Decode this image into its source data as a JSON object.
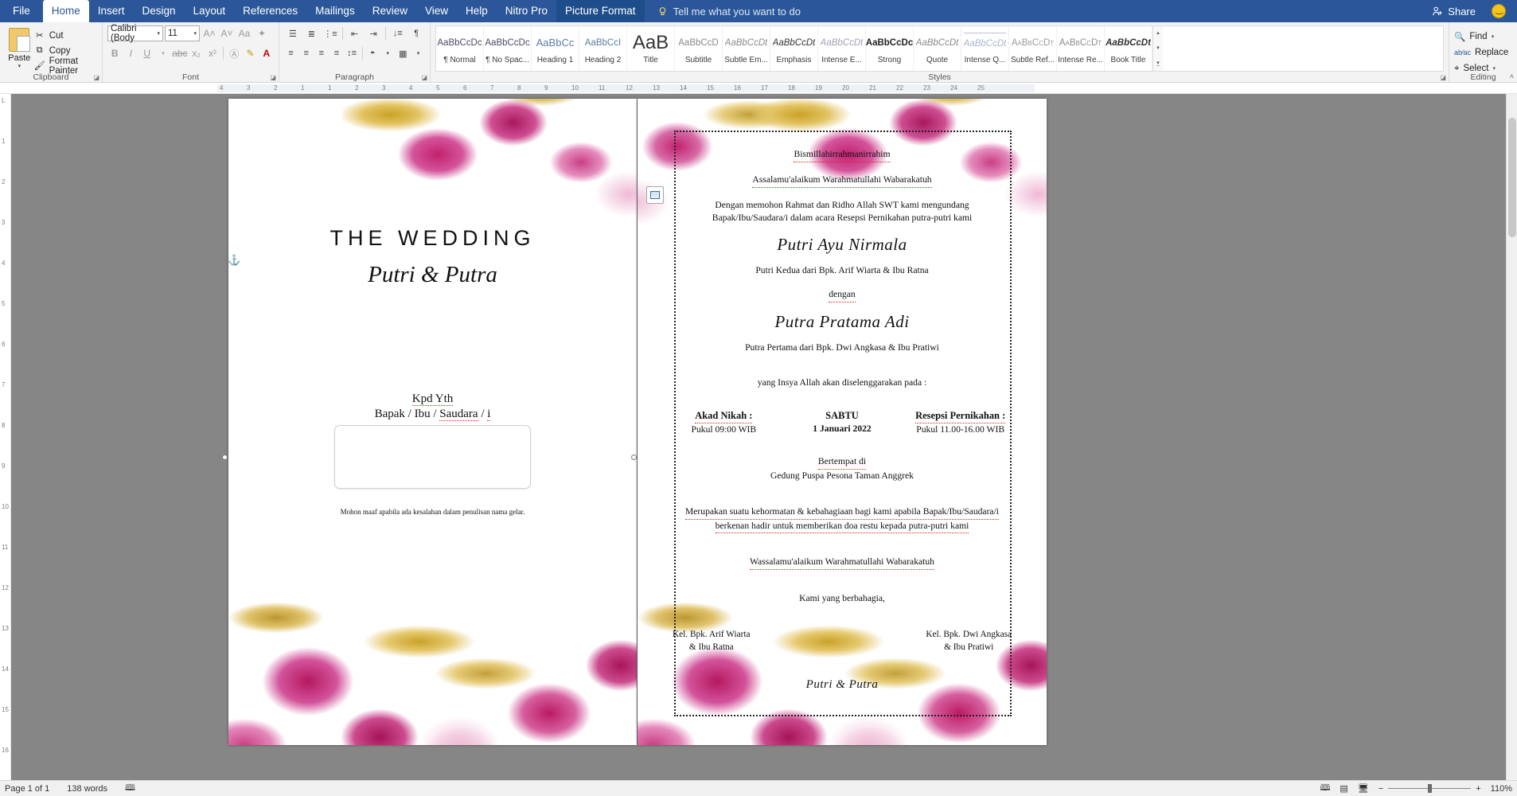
{
  "titlebar": {
    "tabs": [
      {
        "label": "File",
        "state": "file"
      },
      {
        "label": "Home",
        "state": "active"
      },
      {
        "label": "Insert",
        "state": "normal"
      },
      {
        "label": "Design",
        "state": "normal"
      },
      {
        "label": "Layout",
        "state": "normal"
      },
      {
        "label": "References",
        "state": "normal"
      },
      {
        "label": "Mailings",
        "state": "normal"
      },
      {
        "label": "Review",
        "state": "normal"
      },
      {
        "label": "View",
        "state": "normal"
      },
      {
        "label": "Help",
        "state": "normal"
      },
      {
        "label": "Nitro Pro",
        "state": "normal"
      },
      {
        "label": "Picture Format",
        "state": "contextual"
      }
    ],
    "tell_me": "Tell me what you want to do",
    "share_label": "Share",
    "accent_color": "#2b579a"
  },
  "ribbon": {
    "clipboard": {
      "group_label": "Clipboard",
      "paste_label": "Paste",
      "items": [
        {
          "label": "Cut",
          "icon": "scissors-icon"
        },
        {
          "label": "Copy",
          "icon": "copy-icon"
        },
        {
          "label": "Format Painter",
          "icon": "paintbrush-icon"
        }
      ]
    },
    "font": {
      "group_label": "Font",
      "font_name": "Calibri (Body",
      "font_size": "11",
      "buttons": [
        "B",
        "I",
        "U",
        "abc",
        "X₂",
        "X²"
      ]
    },
    "paragraph": {
      "group_label": "Paragraph"
    },
    "styles": {
      "group_label": "Styles",
      "items": [
        {
          "preview": "AaBbCcDc",
          "name": "¶ Normal"
        },
        {
          "preview": "AaBbCcDc",
          "name": "¶ No Spac..."
        },
        {
          "preview": "AaBbCc",
          "name": "Heading 1"
        },
        {
          "preview": "AaBbCcI",
          "name": "Heading 2"
        },
        {
          "preview": "AaB",
          "name": "Title"
        },
        {
          "preview": "AaBbCcD",
          "name": "Subtitle"
        },
        {
          "preview": "AaBbCcDt",
          "name": "Subtle Em..."
        },
        {
          "preview": "AaBbCcDt",
          "name": "Emphasis"
        },
        {
          "preview": "AaBbCcDt",
          "name": "Intense E..."
        },
        {
          "preview": "AaBbCcDc",
          "name": "Strong"
        },
        {
          "preview": "AaBbCcDt",
          "name": "Quote"
        },
        {
          "preview": "AaBbCcDt",
          "name": "Intense Q..."
        },
        {
          "preview": "AaBbCcDt",
          "name": "Subtle Ref..."
        },
        {
          "preview": "AaBbCcDt",
          "name": "Intense Re..."
        },
        {
          "preview": "AaBbCcDt",
          "name": "Book Title"
        }
      ]
    },
    "editing": {
      "group_label": "Editing",
      "items": [
        {
          "label": "Find",
          "icon": "magnifier-icon"
        },
        {
          "label": "Replace",
          "icon": "replace-icon"
        },
        {
          "label": "Select",
          "icon": "cursor-icon"
        }
      ]
    }
  },
  "ruler": {
    "h_ticks": [
      "4",
      "3",
      "2",
      "1",
      "1",
      "2",
      "3",
      "4",
      "5",
      "6",
      "7",
      "8",
      "9",
      "10",
      "11",
      "12",
      "13",
      "14",
      "15",
      "16",
      "17",
      "18",
      "19",
      "20",
      "21",
      "22",
      "23",
      "24",
      "25"
    ],
    "v_ticks": [
      "L",
      "1",
      "2",
      "3",
      "4",
      "5",
      "6",
      "7",
      "8",
      "9",
      "10",
      "11",
      "12",
      "13",
      "14",
      "15",
      "16"
    ]
  },
  "document": {
    "left_page": {
      "title": "THE WEDDING",
      "couple": "Putri & Putra",
      "kpd_line1": "Kpd Yth",
      "kpd_line2_a": "Bapak / Ibu / ",
      "kpd_line2_b": "Saudara",
      "kpd_line2_c": " / ",
      "kpd_line2_d": "i",
      "note": "Mohon maaf apabila ada kesalahan dalam penulisan nama gelar."
    },
    "right_page": {
      "bismillah": "Bismillahirrahmanirrahim",
      "salam": "Assalamu'alaikum Warahmatullahi Wabarakatuh",
      "intro_line1": "Dengan memohon Rahmat dan Ridho Allah SWT kami mengundang",
      "intro_line2": "Bapak/Ibu/Saudara/i dalam acara Resepsi Pernikahan putra-putri kami",
      "bride_name": "Putri Ayu Nirmala",
      "bride_parents": "Putri Kedua dari Bpk. Arif Wiarta & Ibu Ratna",
      "dengan": "dengan",
      "groom_name": "Putra Pratama Adi",
      "groom_parents": "Putra Pertama dari Bpk. Dwi Angkasa & Ibu Pratiwi",
      "schedule_intro": "yang Insya Allah akan diselenggarakan pada :",
      "akad_title": "Akad Nikah :",
      "akad_time": "Pukul 09:00 WIB",
      "day": "SABTU",
      "date": "1 Januari 2022",
      "resepsi_title": "Resepsi Pernikahan :",
      "resepsi_time": "Pukul 11.00-16.00 WIB",
      "venue_label": "Bertempat di",
      "venue_name": "Gedung Puspa Pesona Taman Anggrek",
      "closing_line1": "Merupakan suatu kehormatan & kebahagiaan bagi kami apabila Bapak/Ibu/Saudara/i",
      "closing_line2": "berkenan hadir untuk memberikan doa restu kepada putra-putri kami",
      "wassalam": "Wassalamu'alaikum Warahmatullahi Wabarakatuh",
      "kami": "Kami yang berbahagia,",
      "family_left_1": "Kel. Bpk. Arif Wiarta",
      "family_left_2": "& Ibu Ratna",
      "family_right_1": "Kel. Bpk. Dwi Angkasa",
      "family_right_2": "& Ibu Pratiwi",
      "footer_script": "Putri & Putra"
    }
  },
  "statusbar": {
    "page": "Page 1 of 1",
    "words": "138 words",
    "proofing_icon": "proofing-errors-icon",
    "zoom": "110%",
    "views": [
      "read-mode-icon",
      "print-layout-icon",
      "web-layout-icon"
    ]
  }
}
